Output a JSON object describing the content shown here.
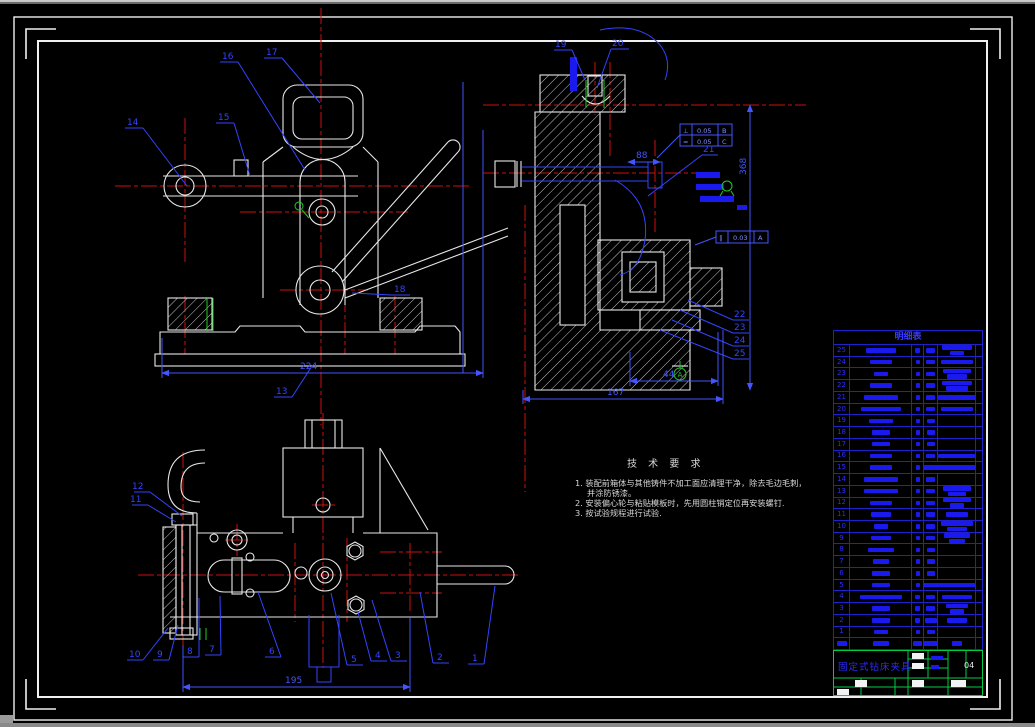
{
  "tech": {
    "title": "技 术 要 求",
    "lines": [
      "1. 装配前箱体与其他铸件不加工面应清理干净，除去毛边毛刺，",
      "并涂防锈漆。",
      "2. 安装偏心轮与粘贴模板时，先用圆柱销定位再安装螺钉.",
      "3. 按试验规程进行试验."
    ]
  },
  "front_view": {
    "dim224": "224",
    "balloons": {
      "b13": "13",
      "b14": "14",
      "b15": "15",
      "b16": "16",
      "b17": "17",
      "b18": "18"
    }
  },
  "side_view": {
    "dims": {
      "d88": "88",
      "d368": "368",
      "d44": "44",
      "d167": "167"
    },
    "tol": {
      "r1s": "⊥",
      "r1v": "0.05",
      "r1d": "B",
      "r2s": "=",
      "r2v": "0.05",
      "r2d": "C",
      "r3s": "∥",
      "r3v": "0.03",
      "r3d": "A"
    },
    "datum_a": "A",
    "balloons": {
      "b19": "19",
      "b20": "20",
      "b21": "21",
      "b22": "22",
      "b23": "23",
      "b24": "24",
      "b25": "25"
    }
  },
  "top_view": {
    "dim195": "195",
    "balloons": {
      "b1": "1",
      "b2": "2",
      "b3": "3",
      "b4": "4",
      "b5": "5",
      "b6": "6",
      "b7": "7",
      "b8": "8",
      "b9": "9",
      "b10": "10",
      "b11": "11",
      "b12": "12"
    }
  },
  "parts_list": {
    "title": "明细表",
    "rows": [
      {
        "no": "25",
        "n": 30,
        "q": 5,
        "m": 9,
        "r": 30,
        "r2": 14
      },
      {
        "no": "24",
        "n": 22,
        "q": 4,
        "m": 9,
        "r": 32,
        "r2": 0
      },
      {
        "no": "23",
        "n": 14,
        "q": 4,
        "m": 9,
        "r": 28,
        "r2": 20
      },
      {
        "no": "22",
        "n": 22,
        "q": 4,
        "m": 9,
        "r": 30,
        "r2": 22
      },
      {
        "no": "21",
        "n": 34,
        "q": 4,
        "m": 9,
        "r": 38,
        "r2": 0
      },
      {
        "no": "20",
        "n": 40,
        "q": 4,
        "m": 9,
        "r": 32,
        "r2": 0
      },
      {
        "no": "19",
        "n": 24,
        "q": 4,
        "m": 8,
        "r": 0,
        "r2": 0
      },
      {
        "no": "18",
        "n": 18,
        "q": 4,
        "m": 8,
        "r": 0,
        "r2": 0
      },
      {
        "no": "17",
        "n": 18,
        "q": 4,
        "m": 8,
        "r": 0,
        "r2": 0
      },
      {
        "no": "16",
        "n": 22,
        "q": 4,
        "m": 9,
        "r": 38,
        "r2": 0
      },
      {
        "no": "15",
        "n": 22,
        "q": 4,
        "m": 58,
        "r": 0,
        "r2": 0,
        "span": true
      },
      {
        "no": "14",
        "n": 34,
        "q": 4,
        "m": 9,
        "r": 0,
        "r2": 0
      },
      {
        "no": "13",
        "n": 34,
        "q": 4,
        "m": 9,
        "r": 28,
        "r2": 18
      },
      {
        "no": "12",
        "n": 22,
        "q": 4,
        "m": 9,
        "r": 28,
        "r2": 14
      },
      {
        "no": "11",
        "n": 20,
        "q": 4,
        "m": 9,
        "r": 22,
        "r2": 0
      },
      {
        "no": "10",
        "n": 14,
        "q": 4,
        "m": 9,
        "r": 32,
        "r2": 20
      },
      {
        "no": "9",
        "n": 20,
        "q": 4,
        "m": 9,
        "r": 26,
        "r2": 16
      },
      {
        "no": "8",
        "n": 26,
        "q": 4,
        "m": 8,
        "r": 0,
        "r2": 0
      },
      {
        "no": "7",
        "n": 16,
        "q": 4,
        "m": 8,
        "r": 0,
        "r2": 0
      },
      {
        "no": "6",
        "n": 18,
        "q": 4,
        "m": 8,
        "r": 0,
        "r2": 0
      },
      {
        "no": "5",
        "n": 18,
        "q": 4,
        "m": 58,
        "r": 0,
        "r2": 0,
        "span": true
      },
      {
        "no": "4",
        "n": 42,
        "q": 5,
        "m": 9,
        "r": 30,
        "r2": 0
      },
      {
        "no": "3",
        "n": 18,
        "q": 5,
        "m": 9,
        "r": 22,
        "r2": 14
      },
      {
        "no": "2",
        "n": 18,
        "q": 5,
        "m": 12,
        "r": 20,
        "r2": 0
      },
      {
        "no": "1",
        "n": 14,
        "q": 4,
        "m": 8,
        "r": 0,
        "r2": 0
      },
      {
        "no": "",
        "nw": 10,
        "n": 16,
        "q": 9,
        "m": 26,
        "r": 10,
        "r2": 0,
        "footer": true
      }
    ]
  },
  "title_block": {
    "title": "固定式钻床夹具",
    "sheet": "04"
  }
}
